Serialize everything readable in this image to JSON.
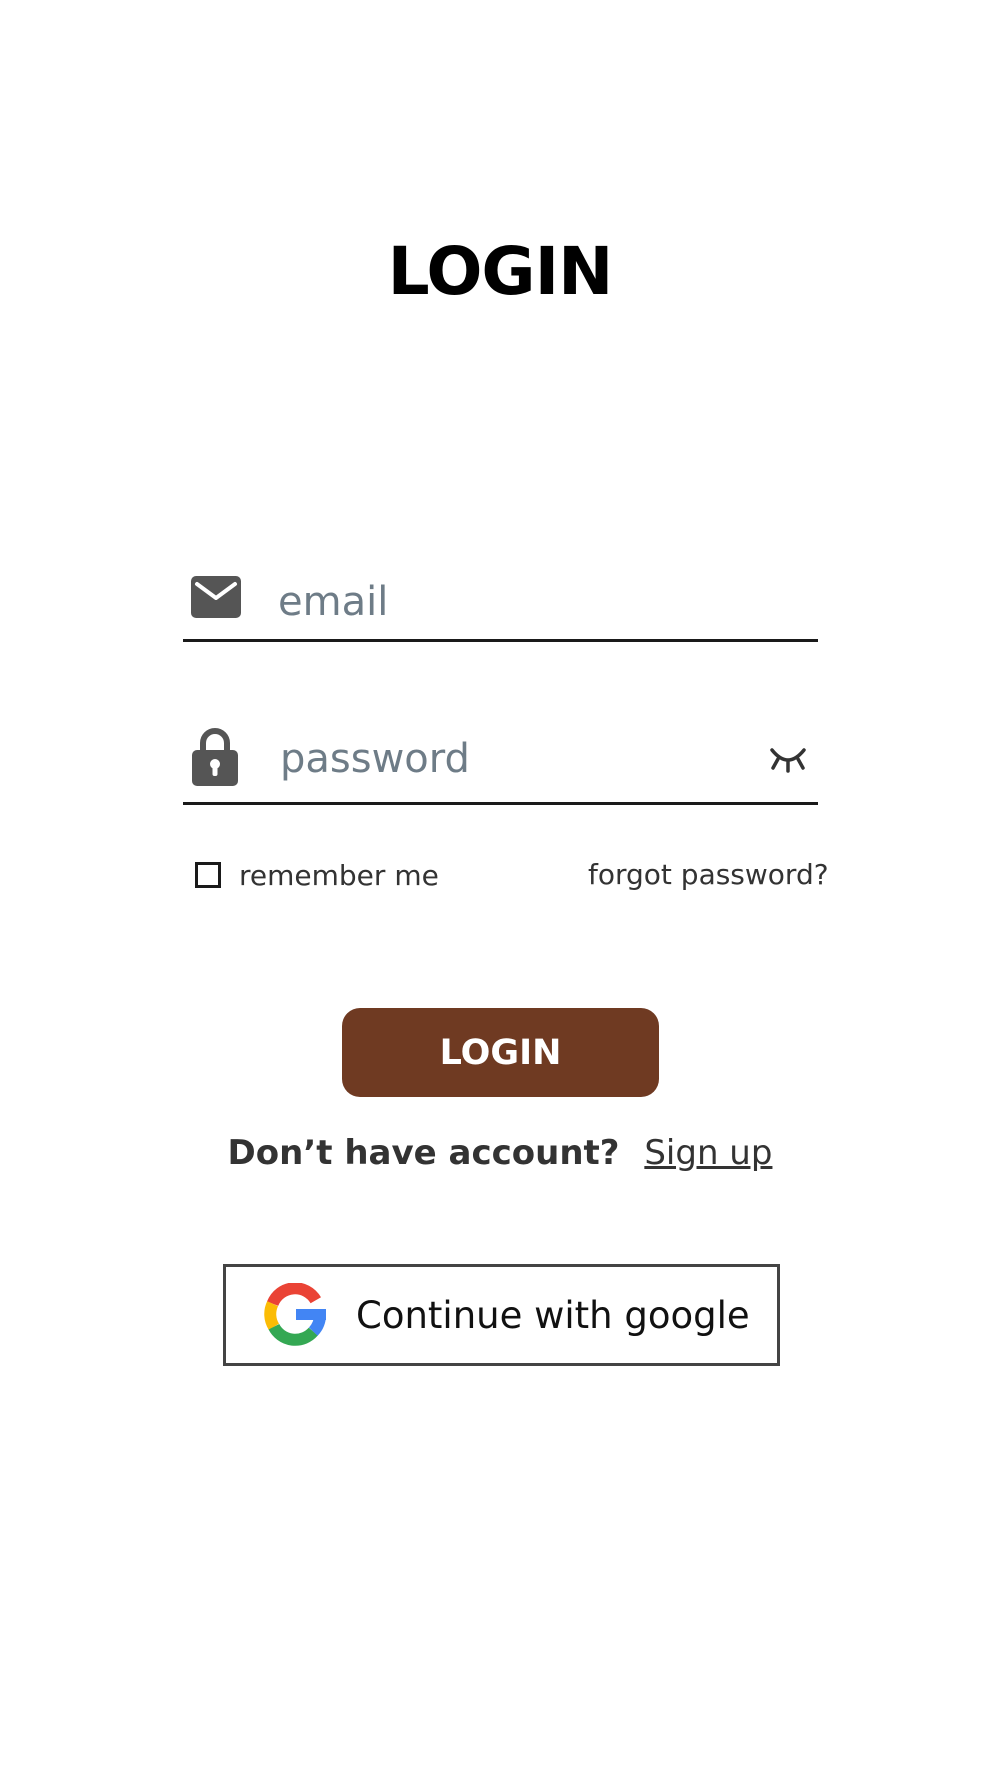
{
  "title": "LOGIN",
  "email": {
    "placeholder": "email",
    "value": "",
    "icon": "envelope-icon"
  },
  "password": {
    "placeholder": "password",
    "value": "",
    "icon": "lock-icon",
    "toggle_icon": "eye-closed-icon"
  },
  "remember": {
    "label": "remember me",
    "checked": false
  },
  "forgot_label": "forgot password?",
  "login_button_label": "LOGIN",
  "signup": {
    "prompt": "Don’t have account?",
    "link_label": "Sign up"
  },
  "google_button": {
    "label": "Continue with google",
    "icon": "google-icon"
  },
  "colors": {
    "primary": "#6f3a22",
    "icon": "#555555",
    "placeholder": "#6e7c87",
    "google_red": "#ea4335",
    "google_yellow": "#fbbc05",
    "google_green": "#34a853",
    "google_blue": "#4285f4"
  }
}
